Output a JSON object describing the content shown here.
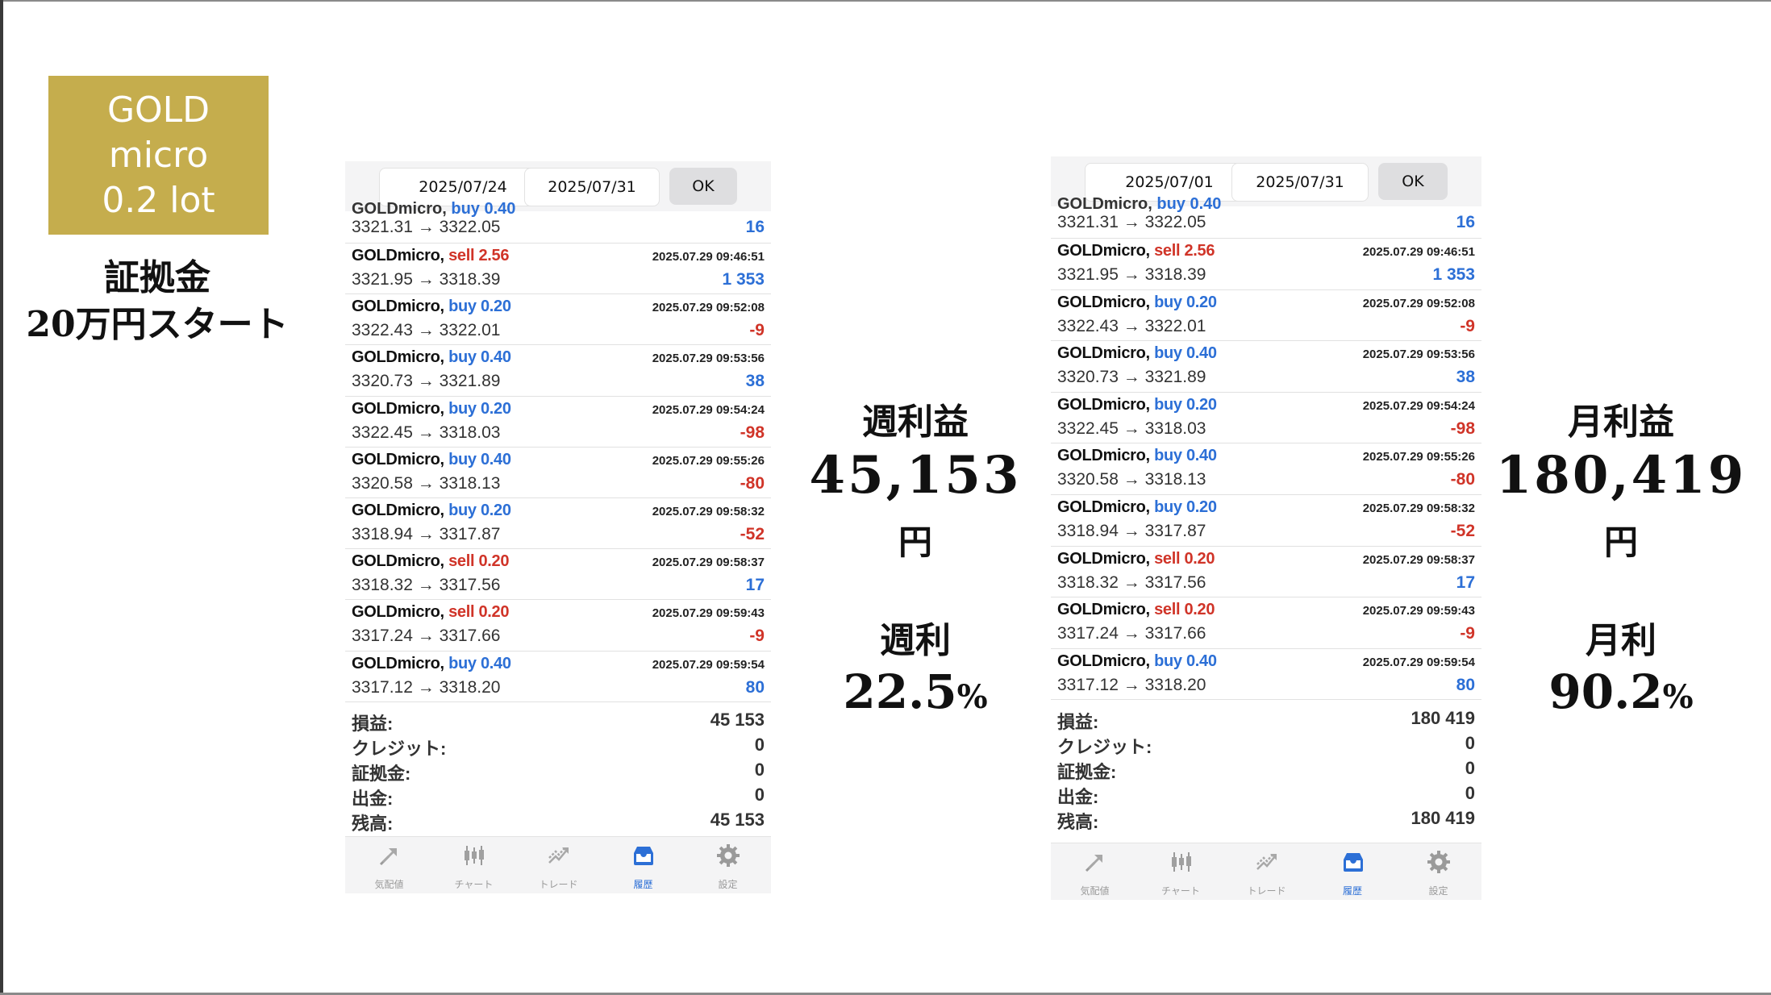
{
  "badge": {
    "line1": "GOLD",
    "line2": "micro",
    "line3": "0.2 lot"
  },
  "deposit": {
    "line1": "証拠金",
    "line2": "20万円スタート"
  },
  "weekly": {
    "profit_label": "週利益",
    "profit_value": "45,153",
    "unit": "円",
    "rate_label": "週利",
    "rate_value": "22.5",
    "rate_unit": "%"
  },
  "monthly": {
    "profit_label": "月利益",
    "profit_value": "180,419",
    "unit": "円",
    "rate_label": "月利",
    "rate_value": "90.2",
    "rate_unit": "%"
  },
  "phone1": {
    "date_from": "2025/07/24",
    "date_to": "2025/07/31",
    "ok_label": "OK",
    "partial": {
      "prices": "3321.31 → 3322.05",
      "profit": "16"
    },
    "trades": [
      {
        "symbol": "GOLDmicro,",
        "dir": "sell 2.56",
        "side": "sell",
        "time": "2025.07.29 09:46:51",
        "prices": "3321.95 → 3318.39",
        "profit": "1 353",
        "sign": "pos"
      },
      {
        "symbol": "GOLDmicro,",
        "dir": "buy 0.20",
        "side": "buy",
        "time": "2025.07.29 09:52:08",
        "prices": "3322.43 → 3322.01",
        "profit": "-9",
        "sign": "neg"
      },
      {
        "symbol": "GOLDmicro,",
        "dir": "buy 0.40",
        "side": "buy",
        "time": "2025.07.29 09:53:56",
        "prices": "3320.73 → 3321.89",
        "profit": "38",
        "sign": "pos"
      },
      {
        "symbol": "GOLDmicro,",
        "dir": "buy 0.20",
        "side": "buy",
        "time": "2025.07.29 09:54:24",
        "prices": "3322.45 → 3318.03",
        "profit": "-98",
        "sign": "neg"
      },
      {
        "symbol": "GOLDmicro,",
        "dir": "buy 0.40",
        "side": "buy",
        "time": "2025.07.29 09:55:26",
        "prices": "3320.58 → 3318.13",
        "profit": "-80",
        "sign": "neg"
      },
      {
        "symbol": "GOLDmicro,",
        "dir": "buy 0.20",
        "side": "buy",
        "time": "2025.07.29 09:58:32",
        "prices": "3318.94 → 3317.87",
        "profit": "-52",
        "sign": "neg"
      },
      {
        "symbol": "GOLDmicro,",
        "dir": "sell 0.20",
        "side": "sell",
        "time": "2025.07.29 09:58:37",
        "prices": "3318.32 → 3317.56",
        "profit": "17",
        "sign": "pos"
      },
      {
        "symbol": "GOLDmicro,",
        "dir": "sell 0.20",
        "side": "sell",
        "time": "2025.07.29 09:59:43",
        "prices": "3317.24 → 3317.66",
        "profit": "-9",
        "sign": "neg"
      },
      {
        "symbol": "GOLDmicro,",
        "dir": "buy 0.40",
        "side": "buy",
        "time": "2025.07.29 09:59:54",
        "prices": "3317.12 → 3318.20",
        "profit": "80",
        "sign": "pos"
      }
    ],
    "summary": [
      {
        "label": "損益:",
        "value": "45 153"
      },
      {
        "label": "クレジット:",
        "value": "0"
      },
      {
        "label": "証拠金:",
        "value": "0"
      },
      {
        "label": "出金:",
        "value": "0"
      },
      {
        "label": "残高:",
        "value": "45 153"
      }
    ]
  },
  "phone2": {
    "date_from": "2025/07/01",
    "date_to": "2025/07/31",
    "ok_label": "OK",
    "partial": {
      "prices": "3321.31 → 3322.05",
      "profit": "16"
    },
    "trades": [
      {
        "symbol": "GOLDmicro,",
        "dir": "sell 2.56",
        "side": "sell",
        "time": "2025.07.29 09:46:51",
        "prices": "3321.95 → 3318.39",
        "profit": "1 353",
        "sign": "pos"
      },
      {
        "symbol": "GOLDmicro,",
        "dir": "buy 0.20",
        "side": "buy",
        "time": "2025.07.29 09:52:08",
        "prices": "3322.43 → 3322.01",
        "profit": "-9",
        "sign": "neg"
      },
      {
        "symbol": "GOLDmicro,",
        "dir": "buy 0.40",
        "side": "buy",
        "time": "2025.07.29 09:53:56",
        "prices": "3320.73 → 3321.89",
        "profit": "38",
        "sign": "pos"
      },
      {
        "symbol": "GOLDmicro,",
        "dir": "buy 0.20",
        "side": "buy",
        "time": "2025.07.29 09:54:24",
        "prices": "3322.45 → 3318.03",
        "profit": "-98",
        "sign": "neg"
      },
      {
        "symbol": "GOLDmicro,",
        "dir": "buy 0.40",
        "side": "buy",
        "time": "2025.07.29 09:55:26",
        "prices": "3320.58 → 3318.13",
        "profit": "-80",
        "sign": "neg"
      },
      {
        "symbol": "GOLDmicro,",
        "dir": "buy 0.20",
        "side": "buy",
        "time": "2025.07.29 09:58:32",
        "prices": "3318.94 → 3317.87",
        "profit": "-52",
        "sign": "neg"
      },
      {
        "symbol": "GOLDmicro,",
        "dir": "sell 0.20",
        "side": "sell",
        "time": "2025.07.29 09:58:37",
        "prices": "3318.32 → 3317.56",
        "profit": "17",
        "sign": "pos"
      },
      {
        "symbol": "GOLDmicro,",
        "dir": "sell 0.20",
        "side": "sell",
        "time": "2025.07.29 09:59:43",
        "prices": "3317.24 → 3317.66",
        "profit": "-9",
        "sign": "neg"
      },
      {
        "symbol": "GOLDmicro,",
        "dir": "buy 0.40",
        "side": "buy",
        "time": "2025.07.29 09:59:54",
        "prices": "3317.12 → 3318.20",
        "profit": "80",
        "sign": "pos"
      }
    ],
    "summary": [
      {
        "label": "損益:",
        "value": "180 419"
      },
      {
        "label": "クレジット:",
        "value": "0"
      },
      {
        "label": "証拠金:",
        "value": "0"
      },
      {
        "label": "出金:",
        "value": "0"
      },
      {
        "label": "残高:",
        "value": "180 419"
      }
    ]
  },
  "tabs": [
    {
      "label": "気配値",
      "icon": "quotes-icon",
      "active": false
    },
    {
      "label": "チャート",
      "icon": "chart-icon",
      "active": false
    },
    {
      "label": "トレード",
      "icon": "trade-icon",
      "active": false
    },
    {
      "label": "履歴",
      "icon": "history-icon",
      "active": true
    },
    {
      "label": "設定",
      "icon": "settings-icon",
      "active": false
    }
  ],
  "colors": {
    "badge_bg": "#c5ad4d",
    "buy": "#2c6fd6",
    "sell": "#d03428",
    "active_tab": "#2c6fd6"
  }
}
